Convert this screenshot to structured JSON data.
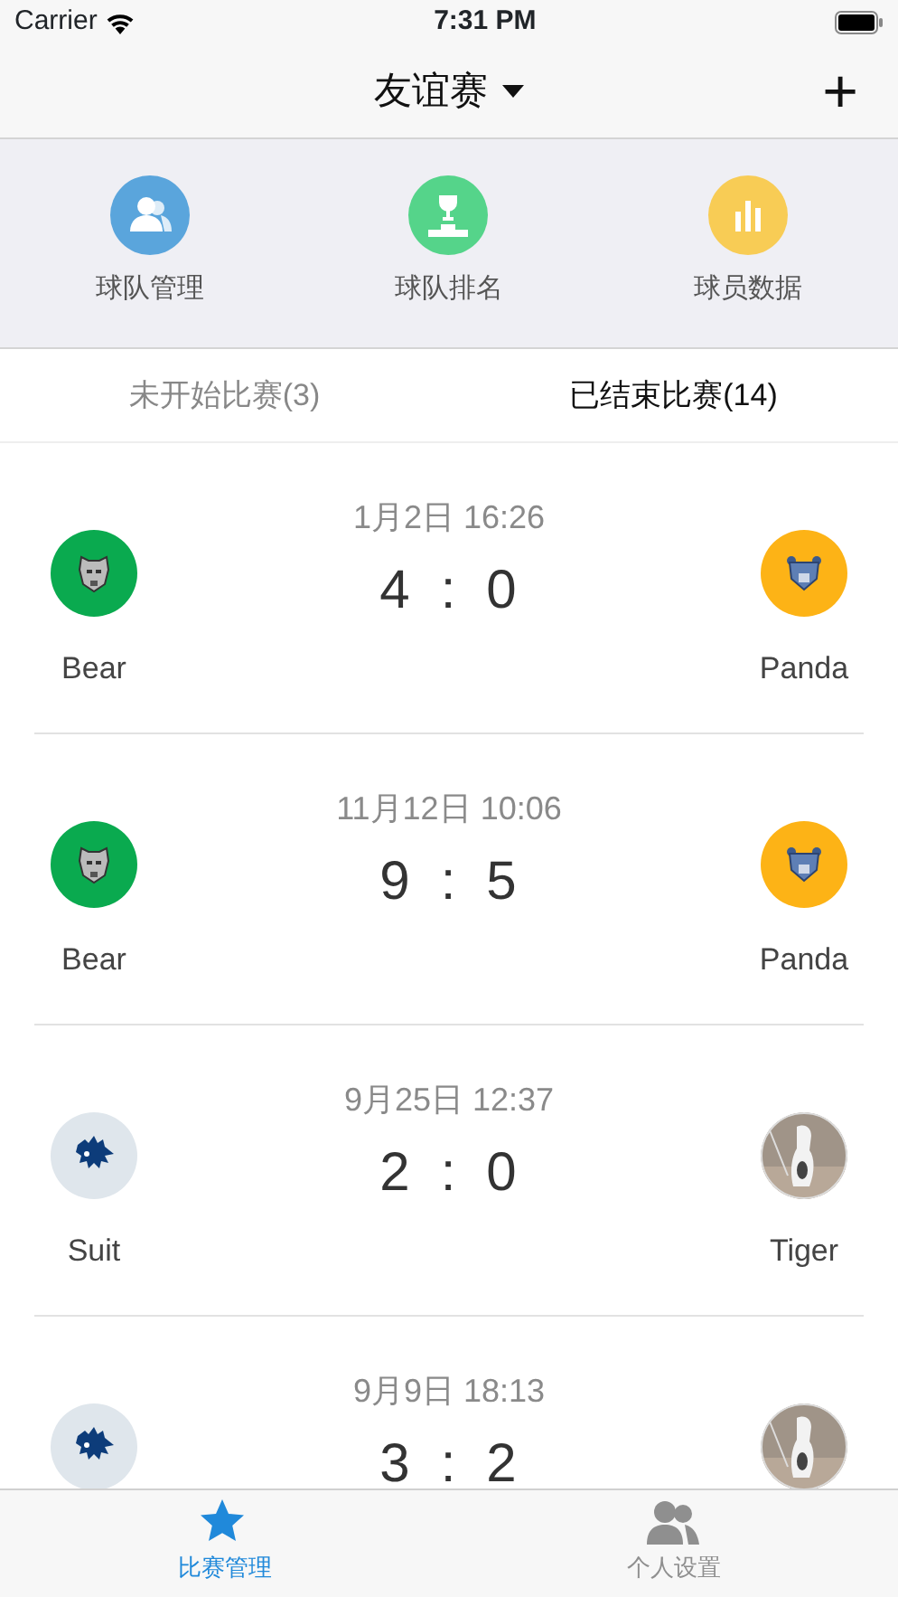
{
  "status_bar": {
    "carrier": "Carrier",
    "time": "7:31 PM"
  },
  "nav": {
    "title": "友谊赛",
    "add": "+"
  },
  "quick_actions": [
    {
      "label": "球队管理",
      "kind": "team",
      "color": "#5aa5dc"
    },
    {
      "label": "球队排名",
      "kind": "rank",
      "color": "#55d48a"
    },
    {
      "label": "球员数据",
      "kind": "stats",
      "color": "#f8cc55"
    }
  ],
  "tabs": [
    {
      "label": "未开始比赛(3)",
      "selected": false
    },
    {
      "label": "已结束比赛(14)",
      "selected": true
    }
  ],
  "matches": [
    {
      "date": "1月2日 16:26",
      "score_home": "4",
      "score_separator": ":",
      "score_away": "0",
      "home": {
        "name": "Bear",
        "kind": "cat",
        "color": "#0aaa4f"
      },
      "away": {
        "name": "Panda",
        "kind": "bear",
        "color": "#fdb316"
      }
    },
    {
      "date": "11月12日 10:06",
      "score_home": "9",
      "score_separator": ":",
      "score_away": "5",
      "home": {
        "name": "Bear",
        "kind": "cat",
        "color": "#0aaa4f"
      },
      "away": {
        "name": "Panda",
        "kind": "bear",
        "color": "#fdb316"
      }
    },
    {
      "date": "9月25日 12:37",
      "score_home": "2",
      "score_separator": ":",
      "score_away": "0",
      "home": {
        "name": "Suit",
        "kind": "lion",
        "color": "#dfe6ec"
      },
      "away": {
        "name": "Tiger",
        "kind": "picture",
        "color": "#a09488"
      }
    },
    {
      "date": "9月9日 18:13",
      "score_home": "3",
      "score_separator": ":",
      "score_away": "2",
      "home": {
        "kind": "lion",
        "color": "#dfe6ec"
      }
    }
  ],
  "tab_bar": [
    {
      "label": "比赛管理",
      "kind": "star",
      "selected": true
    },
    {
      "label": "个人设置",
      "kind": "people",
      "selected": false
    }
  ]
}
